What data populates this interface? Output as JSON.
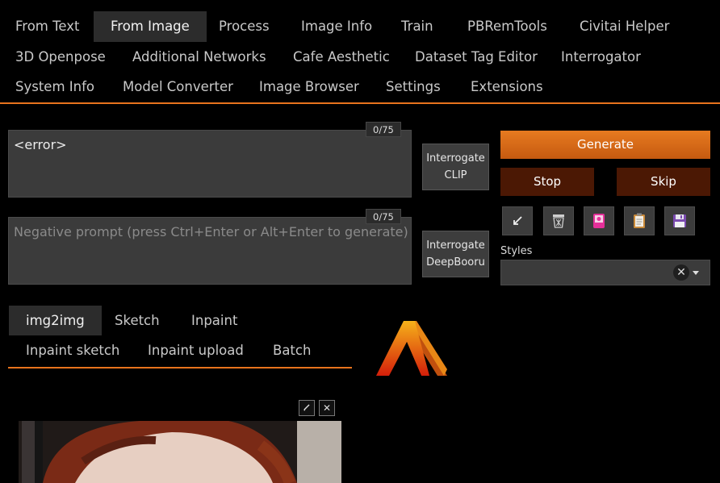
{
  "nav": {
    "rows": [
      [
        {
          "label": "From Text",
          "active": false
        },
        {
          "label": "From Image",
          "active": true
        },
        {
          "label": "Process",
          "active": false
        },
        {
          "label": "Image Info",
          "active": false
        },
        {
          "label": "Train",
          "active": false
        },
        {
          "label": "PBRemTools",
          "active": false
        },
        {
          "label": "Civitai Helper",
          "active": false
        }
      ],
      [
        {
          "label": "3D Openpose",
          "active": false
        },
        {
          "label": "Additional Networks",
          "active": false
        },
        {
          "label": "Cafe Aesthetic",
          "active": false
        },
        {
          "label": "Dataset Tag Editor",
          "active": false
        },
        {
          "label": "Interrogator",
          "active": false
        }
      ],
      [
        {
          "label": "System Info",
          "active": false
        },
        {
          "label": "Model Converter",
          "active": false
        },
        {
          "label": "Image Browser",
          "active": false
        },
        {
          "label": "Settings",
          "active": false
        },
        {
          "label": "Extensions",
          "active": false
        }
      ]
    ]
  },
  "prompt": {
    "value": "<error>",
    "counter": "0/75"
  },
  "negative_prompt": {
    "placeholder": "Negative prompt (press Ctrl+Enter or Alt+Enter to generate)",
    "counter": "0/75"
  },
  "interrogate_clip": {
    "line1": "Interrogate",
    "line2": "CLIP"
  },
  "interrogate_deepbooru": {
    "line1": "Interrogate",
    "line2": "DeepBooru"
  },
  "actions": {
    "generate": "Generate",
    "stop": "Stop",
    "skip": "Skip"
  },
  "tools": [
    "arrow-icon",
    "trash-icon",
    "pink-card-icon",
    "clipboard-icon",
    "save-icon"
  ],
  "styles": {
    "label": "Styles",
    "value": ""
  },
  "img_tabs": {
    "row1": [
      {
        "label": "img2img",
        "active": true
      },
      {
        "label": "Sketch",
        "active": false
      },
      {
        "label": "Inpaint",
        "active": false
      }
    ],
    "row2": [
      {
        "label": "Inpaint sketch",
        "active": false
      },
      {
        "label": "Inpaint upload",
        "active": false
      },
      {
        "label": "Batch",
        "active": false
      }
    ]
  },
  "colors": {
    "accent": "#e8731d",
    "generate": "#d9691a",
    "stop_skip": "#4b1804",
    "background": "#000000"
  }
}
